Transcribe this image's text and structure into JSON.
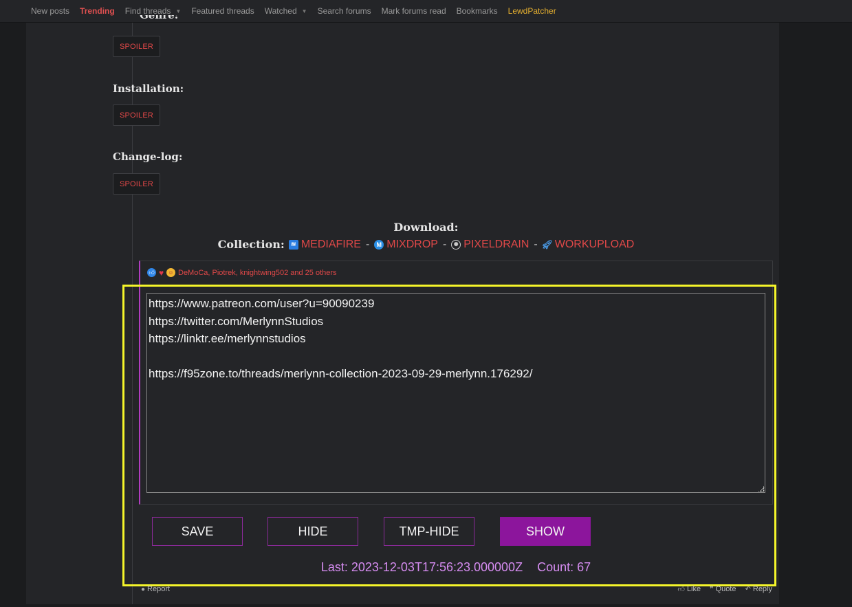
{
  "nav": {
    "items": [
      {
        "label": "New posts",
        "style": "normal",
        "dropdown": false
      },
      {
        "label": "Trending",
        "style": "trending",
        "dropdown": false
      },
      {
        "label": "Find threads",
        "style": "normal",
        "dropdown": true
      },
      {
        "label": "Featured threads",
        "style": "normal",
        "dropdown": false
      },
      {
        "label": "Watched",
        "style": "normal",
        "dropdown": true
      },
      {
        "label": "Search forums",
        "style": "normal",
        "dropdown": false
      },
      {
        "label": "Mark forums read",
        "style": "normal",
        "dropdown": false
      },
      {
        "label": "Bookmarks",
        "style": "normal",
        "dropdown": false
      },
      {
        "label": "LewdPatcher",
        "style": "lewd",
        "dropdown": false
      }
    ]
  },
  "post": {
    "cut_label": "Genre:",
    "sections": [
      {
        "label": "Installation:"
      },
      {
        "label": "Change-log:"
      }
    ],
    "spoiler_label": "SPOILER",
    "download_title": "Download:",
    "collection_label": "Collection:",
    "links": [
      {
        "label": "MEDIAFIRE",
        "icon": "mediafire-icon"
      },
      {
        "label": "MIXDROP",
        "icon": "mixdrop-icon"
      },
      {
        "label": "PIXELDRAIN",
        "icon": "pixeldrain-icon"
      },
      {
        "label": "WORKUPLOAD",
        "icon": "workupload-icon"
      }
    ],
    "separator": "-",
    "reactions": "DeMoCa, Piotrek, knightwing502 and 25 others"
  },
  "notes": {
    "lines": [
      "https://www.patreon.com/user?u=90090239",
      "https://twitter.com/MerlynnStudios",
      "https://linktr.ee/merlynnstudios",
      "",
      "https://f95zone.to/threads/merlynn-collection-2023-09-29-merlynn.176292/"
    ]
  },
  "buttons": {
    "save": "SAVE",
    "hide": "HIDE",
    "tmp_hide": "TMP-HIDE",
    "show": "SHOW"
  },
  "status": {
    "last": "Last: 2023-12-03T17:56:23.000000Z",
    "count": "Count: 67"
  },
  "footer": {
    "report": "Report",
    "like": "Like",
    "quote": "Quote",
    "reply": "Reply"
  },
  "colors": {
    "accent_red": "#e04848",
    "highlight": "#f5f52a",
    "purple": "#8c159c",
    "status_text": "#d58cf0"
  }
}
